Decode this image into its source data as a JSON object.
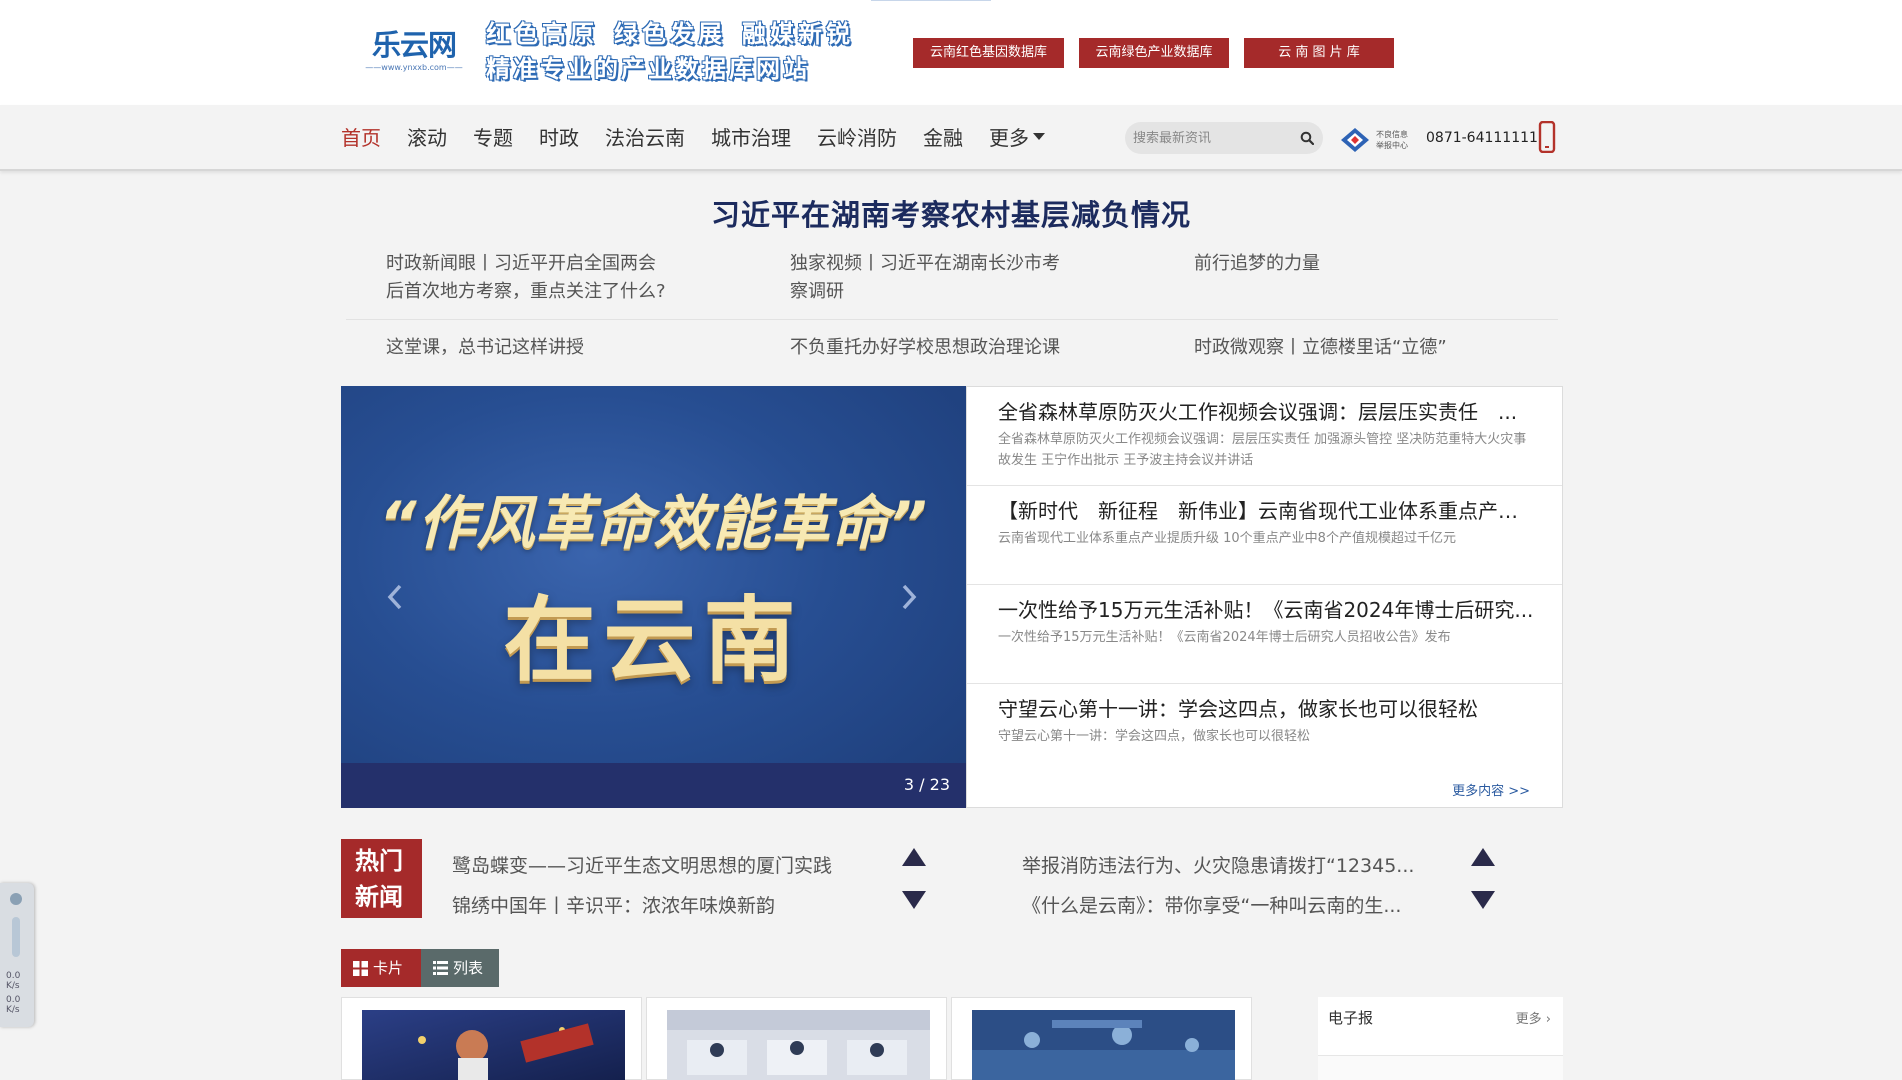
{
  "header": {
    "logo_text": "乐云网",
    "logo_url_text": "——www.ynxxb.com——",
    "slogan_line1": [
      "红色高原",
      "绿色发展",
      "融媒新锐"
    ],
    "slogan_line2": "精准专业的产业数据库网站",
    "db_buttons": [
      "云南红色基因数据库",
      "云南绿色产业数据库",
      "云 南 图 片 库"
    ]
  },
  "nav": {
    "items": [
      "首页",
      "滚动",
      "专题",
      "时政",
      "法治云南",
      "城市治理",
      "云岭消防",
      "金融",
      "更多"
    ],
    "search_placeholder": "搜索最新资讯",
    "report_text_line1": "不良信息",
    "report_text_line2": "举报中心",
    "report_phone": "0871-64111111"
  },
  "headline": {
    "title": "习近平在湖南考察农村基层减负情况",
    "sub_row1": [
      "时政新闻眼丨习近平开启全国两会后首次地方考察，重点关注了什么?",
      "独家视频丨习近平在湖南长沙市考察调研",
      "前行追梦的力量"
    ],
    "sub_row2": [
      "这堂课，总书记这样讲授",
      "不负重托办好学校思想政治理论课",
      "时政微观察丨立德楼里话“立德”"
    ]
  },
  "carousel": {
    "text_line1": "“作风革命效能革命”",
    "text_line2": "在云南",
    "counter": "3 / 23"
  },
  "news": {
    "items": [
      {
        "title": "全省森林草原防灭火工作视频会议强调：层层压实责任　...",
        "desc": "全省森林草原防灭火工作视频会议强调：层层压实责任 加强源头管控 坚决防范重特大火灾事故发生 王宁作出批示 王予波主持会议并讲话"
      },
      {
        "title": "【新时代　新征程　新伟业】云南省现代工业体系重点产业...",
        "desc": "云南省现代工业体系重点产业提质升级 10个重点产业中8个产值规模超过千亿元"
      },
      {
        "title": "一次性给予15万元生活补贴！《云南省2024年博士后研究...",
        "desc": "一次性给予15万元生活补贴！《云南省2024年博士后研究人员招收公告》发布"
      },
      {
        "title": "守望云心第十一讲：学会这四点，做家长也可以很轻松",
        "desc": "守望云心第十一讲：学会这四点，做家长也可以很轻松"
      }
    ],
    "more": "更多内容 >>"
  },
  "hot": {
    "label_line1": "热门",
    "label_line2": "新闻",
    "left": [
      "鹭岛蝶变——习近平生态文明思想的厦门实践",
      "锦绣中国年丨辛识平：浓浓年味焕新韵"
    ],
    "right": [
      "举报消防违法行为、火灾隐患请拨打“12345...",
      "《什么是云南》：带你享受“一种叫云南的生..."
    ]
  },
  "view_tabs": {
    "card": "卡片",
    "list": "列表"
  },
  "epaper": {
    "title": "电子报",
    "more": "更多"
  },
  "widget": {
    "up": "0.0",
    "up_unit": "K/s",
    "down": "0.0",
    "down_unit": "K/s"
  },
  "colors": {
    "brand_red": "#a52a2a",
    "nav_active": "#b3322a",
    "headline": "#1c2b5e",
    "link_blue": "#2a5aa0"
  }
}
